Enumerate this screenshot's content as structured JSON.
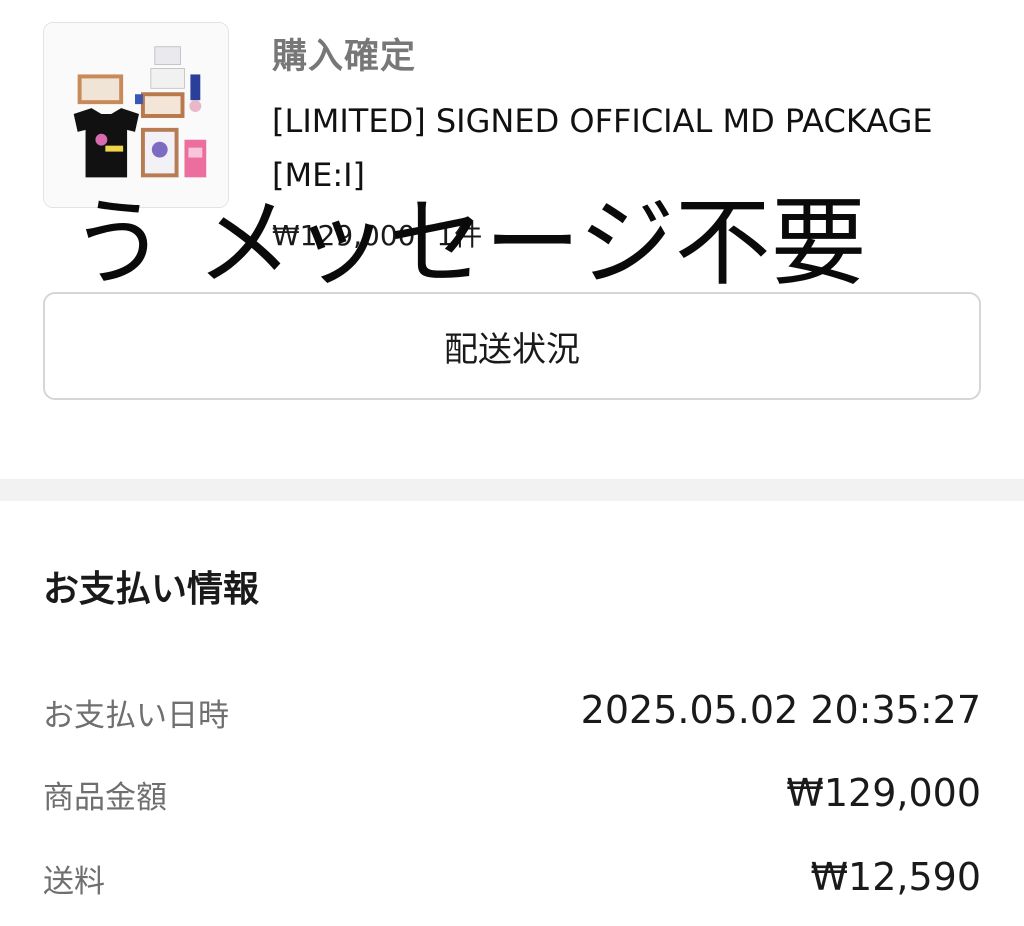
{
  "order": {
    "status": "購入確定",
    "product_title_line1": "[LIMITED] SIGNED OFFICIAL MD PACKAGE",
    "product_title_line2": "[ME:I]",
    "price": "₩129,000",
    "quantity": "1件",
    "shipping_button_label": "配送状況"
  },
  "handwritten_note": "う メッセージ不要",
  "payment": {
    "title": "お支払い情報",
    "rows": [
      {
        "label": "お支払い日時",
        "value": "2025.05.02 20:35:27"
      },
      {
        "label": "商品金額",
        "value": "₩129,000"
      },
      {
        "label": "送料",
        "value": "₩12,590"
      }
    ]
  },
  "colors": {
    "background": "#ffffff",
    "divider": "#f2f2f2",
    "muted_text": "#6f6f6f",
    "border": "#d6d6d6"
  }
}
